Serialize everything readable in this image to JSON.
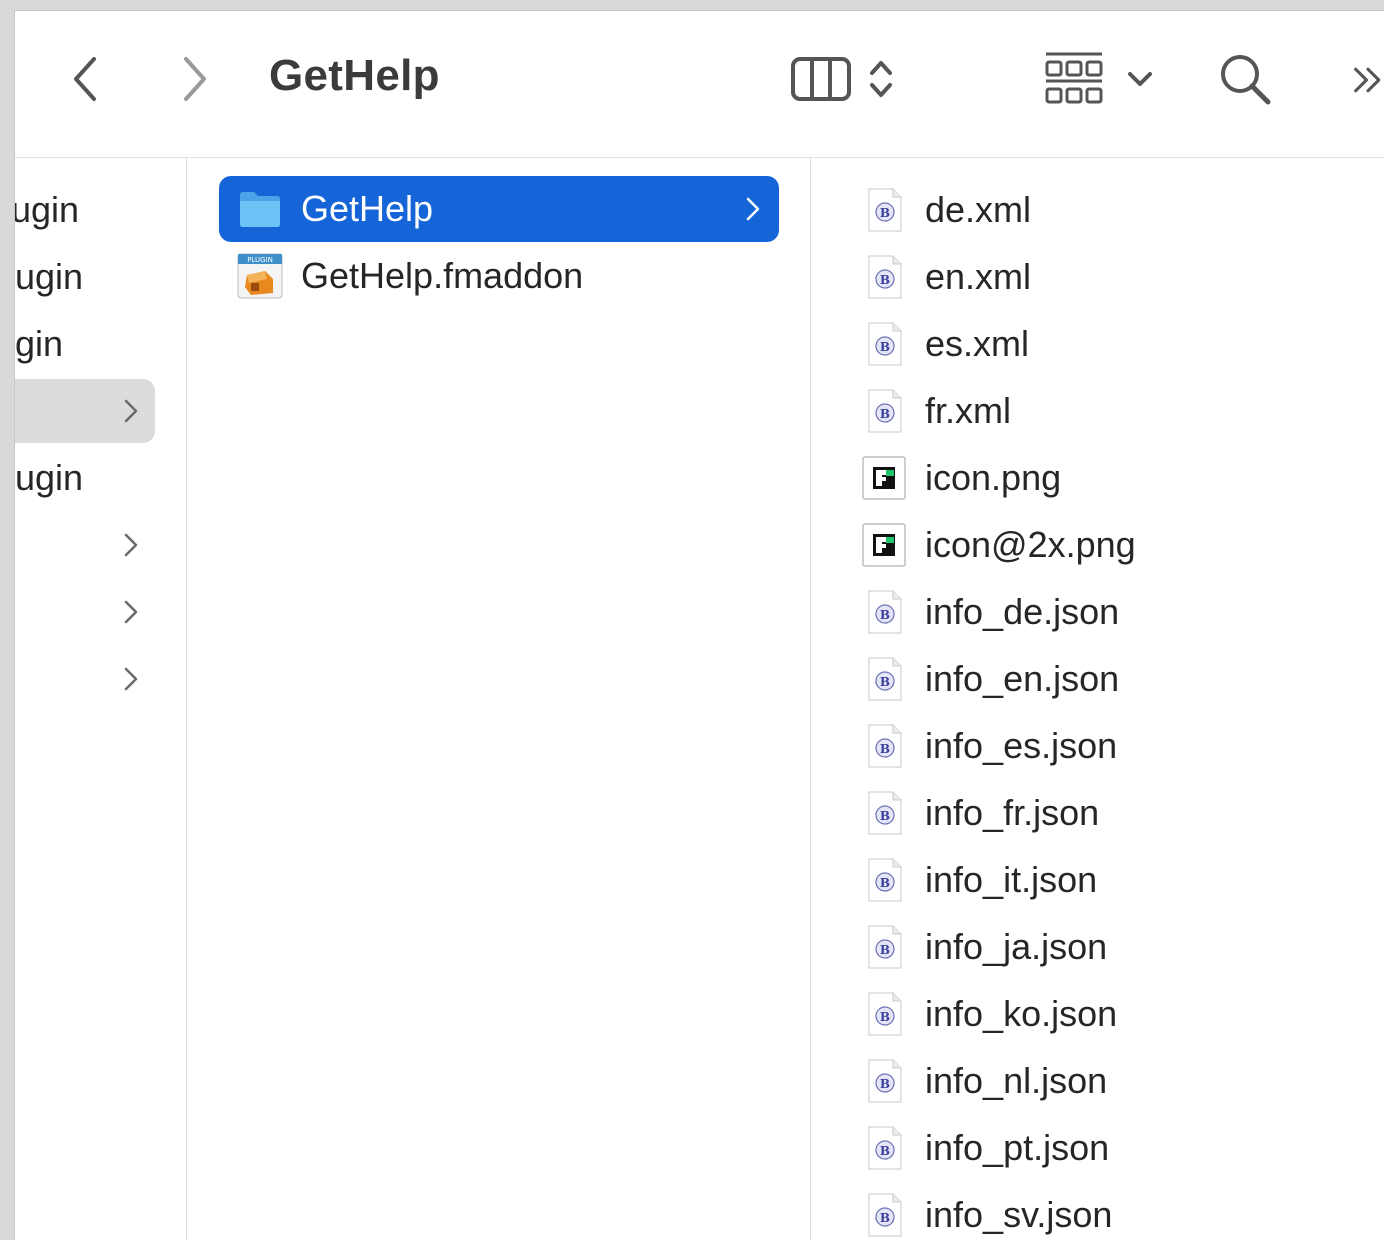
{
  "toolbar": {
    "title": "GetHelp",
    "back_icon": "chevron-left-icon",
    "forward_icon": "chevron-right-icon",
    "view_icon": "columns-view-icon",
    "group_icon": "grid-group-icon",
    "search_icon": "search-icon",
    "overflow_icon": "double-chevron-right-icon"
  },
  "col1": {
    "items": [
      {
        "label": "lugin",
        "has_chevron": false,
        "selected": false
      },
      {
        "label": "ugin",
        "has_chevron": false,
        "selected": false
      },
      {
        "label": "gin",
        "has_chevron": false,
        "selected": false
      },
      {
        "label": "",
        "has_chevron": true,
        "selected": true
      },
      {
        "label": "ugin",
        "has_chevron": false,
        "selected": false
      },
      {
        "label": "",
        "has_chevron": true,
        "selected": false
      },
      {
        "label": "",
        "has_chevron": true,
        "selected": false
      },
      {
        "label": "",
        "has_chevron": true,
        "selected": false
      }
    ]
  },
  "col2": {
    "items": [
      {
        "label": "GetHelp",
        "icon": "folder-icon",
        "active": true,
        "has_chevron": true
      },
      {
        "label": "GetHelp.fmaddon",
        "icon": "plugin-icon",
        "active": false,
        "has_chevron": false
      }
    ],
    "plugin_badge": "PLUGIN"
  },
  "col3": {
    "items": [
      {
        "label": "de.xml",
        "icon": "bbedit-doc-icon"
      },
      {
        "label": "en.xml",
        "icon": "bbedit-doc-icon"
      },
      {
        "label": "es.xml",
        "icon": "bbedit-doc-icon"
      },
      {
        "label": "fr.xml",
        "icon": "bbedit-doc-icon"
      },
      {
        "label": "icon.png",
        "icon": "image-icon"
      },
      {
        "label": "icon@2x.png",
        "icon": "image-icon"
      },
      {
        "label": "info_de.json",
        "icon": "bbedit-doc-icon"
      },
      {
        "label": "info_en.json",
        "icon": "bbedit-doc-icon"
      },
      {
        "label": "info_es.json",
        "icon": "bbedit-doc-icon"
      },
      {
        "label": "info_fr.json",
        "icon": "bbedit-doc-icon"
      },
      {
        "label": "info_it.json",
        "icon": "bbedit-doc-icon"
      },
      {
        "label": "info_ja.json",
        "icon": "bbedit-doc-icon"
      },
      {
        "label": "info_ko.json",
        "icon": "bbedit-doc-icon"
      },
      {
        "label": "info_nl.json",
        "icon": "bbedit-doc-icon"
      },
      {
        "label": "info_pt.json",
        "icon": "bbedit-doc-icon"
      },
      {
        "label": "info_sv.json",
        "icon": "bbedit-doc-icon"
      }
    ]
  },
  "colors": {
    "selection": "#1565d8",
    "inactive_selection": "#dcdcdc",
    "folder": "#5bb5f0"
  }
}
